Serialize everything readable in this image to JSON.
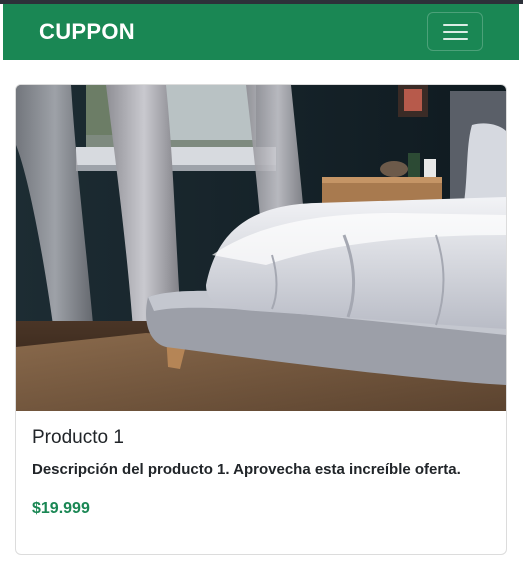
{
  "navbar": {
    "brand": "CUPPON",
    "color": "#1a8754",
    "toggler_icon": "hamburger-menu-icon"
  },
  "products": [
    {
      "title": "Producto 1",
      "description": "Descripción del producto 1. Aprovecha esta increíble oferta.",
      "price": "$19.999",
      "price_color": "#1a8754"
    }
  ]
}
